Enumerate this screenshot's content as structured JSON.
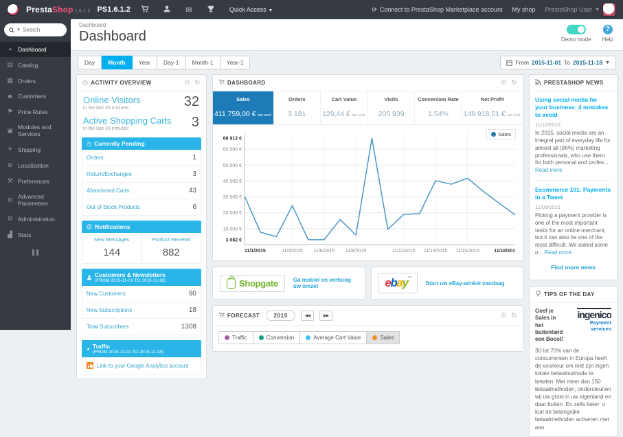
{
  "colors": {
    "topbar_bg": "#363a42",
    "accent_cyan": "#00aff0",
    "section_header": "#29b5e8",
    "sales_tile": "#1d7cb8",
    "chart_line": "#4a96c8",
    "brand_pink": "#f25479",
    "toggle_teal": "#41d6c3",
    "shopgate_green": "#6fb52e",
    "ingenico_navy": "#222c3a",
    "ingenico_blue": "#1274c4",
    "ebay": [
      "#e53238",
      "#0064d2",
      "#f5af02",
      "#86b817"
    ],
    "forecast_traffic": "#a55ca5",
    "forecast_conversion": "#119c80",
    "forecast_avg_cart": "#3fc4f1",
    "forecast_sales": "#f09028"
  },
  "topbar": {
    "brand_presta": "Presta",
    "brand_shop": "Shop",
    "version": "1.6.1.2",
    "shop_name": "PS1.6.1.2",
    "quick_access": "Quick Access",
    "marketplace_link": "Connect to PrestaShop Marketplace account",
    "my_shop": "My shop",
    "user": "PrestaShop User"
  },
  "sidebar": {
    "search_placeholder": "Search",
    "items": [
      {
        "label": "Dashboard"
      },
      {
        "label": "Catalog"
      },
      {
        "label": "Orders"
      },
      {
        "label": "Customers"
      },
      {
        "label": "Price Rules"
      },
      {
        "label": "Modules and Services"
      },
      {
        "label": "Shipping"
      },
      {
        "label": "Localization"
      },
      {
        "label": "Preferences"
      },
      {
        "label": "Advanced Parameters"
      },
      {
        "label": "Administration"
      },
      {
        "label": "Stats"
      }
    ]
  },
  "page": {
    "breadcrumb": "Dashboard",
    "title": "Dashboard",
    "demo_label": "Demo mode",
    "help_label": "Help"
  },
  "toolbar": {
    "ranges": [
      "Day",
      "Month",
      "Year",
      "Day-1",
      "Month-1",
      "Year-1"
    ],
    "from_label": "From",
    "from_date": "2015-11-01",
    "to_label": "To",
    "to_date": "2015-11-18"
  },
  "activity": {
    "title": "ACTIVITY OVERVIEW",
    "online_visitors": {
      "label": "Online Visitors",
      "sub": "in the last 30 minutes",
      "value": "32"
    },
    "active_carts": {
      "label": "Active Shopping Carts",
      "sub": "in the last 30 minutes",
      "value": "3"
    },
    "pending": {
      "header": "Currently Pending",
      "rows": [
        {
          "label": "Orders",
          "value": "1"
        },
        {
          "label": "Return/Exchanges",
          "value": "3"
        },
        {
          "label": "Abandoned Carts",
          "value": "43"
        },
        {
          "label": "Out of Stock Products",
          "value": "6"
        }
      ]
    },
    "notifications": {
      "header": "Notifications",
      "cols": [
        {
          "label": "New Messages",
          "value": "144"
        },
        {
          "label": "Product Reviews",
          "value": "882"
        }
      ]
    },
    "customers": {
      "header": "Customers & Newsletters",
      "sub": "(FROM 2015-11-01 TO 2015-11-18)",
      "rows": [
        {
          "label": "New Customers",
          "value": "90"
        },
        {
          "label": "New Subscriptions",
          "value": "18"
        },
        {
          "label": "Total Subscribers",
          "value": "1308"
        }
      ]
    },
    "traffic": {
      "header": "Traffic",
      "sub": "(FROM 2015-11-01 TO 2015-11-18)",
      "link": "Link to your Google Analytics account"
    }
  },
  "dashboard": {
    "title": "DASHBOARD",
    "kpis": [
      {
        "label": "Sales",
        "value": "411 759,00 €",
        "note": "tax excl.",
        "active": true
      },
      {
        "label": "Orders",
        "value": "3 181",
        "note": ""
      },
      {
        "label": "Cart Value",
        "value": "129,44 €",
        "note": "tax excl."
      },
      {
        "label": "Visits",
        "value": "205 939",
        "note": ""
      },
      {
        "label": "Conversion Rate",
        "value": "1.54%",
        "note": ""
      },
      {
        "label": "Net Profit",
        "value": "148 918,51 €",
        "note": "tax excl."
      }
    ]
  },
  "chart_data": {
    "type": "line",
    "legend": "Sales",
    "line_color": "#4a96c8",
    "ylim": [
      0,
      70000
    ],
    "x": [
      "11/1",
      "11/2",
      "11/3",
      "11/4",
      "11/5",
      "11/6",
      "11/7",
      "11/8",
      "11/9",
      "11/10",
      "11/11",
      "11/12",
      "11/13",
      "11/14",
      "11/15",
      "11/16",
      "11/17",
      "11/18"
    ],
    "values": [
      30500,
      7800,
      5000,
      24500,
      3082,
      3100,
      15800,
      6000,
      66912,
      9500,
      19000,
      19500,
      40200,
      38000,
      41800,
      33500,
      26000,
      18700
    ],
    "y_ticks": [
      {
        "v": 66912,
        "label": "66 912 €",
        "bold": true,
        "grid": false
      },
      {
        "v": 60000,
        "label": "60 000 €",
        "bold": false,
        "grid": true
      },
      {
        "v": 50000,
        "label": "50 000 €",
        "bold": false,
        "grid": true
      },
      {
        "v": 40000,
        "label": "40 000 €",
        "bold": false,
        "grid": true
      },
      {
        "v": 30000,
        "label": "30 000 €",
        "bold": false,
        "grid": true
      },
      {
        "v": 20000,
        "label": "20 000 €",
        "bold": false,
        "grid": true
      },
      {
        "v": 10000,
        "label": "10 000 €",
        "bold": false,
        "grid": true
      },
      {
        "v": 3082,
        "label": "3 082 €",
        "bold": true,
        "grid": false
      }
    ],
    "x_ticks": [
      {
        "i": 0,
        "label": "11/1/2015",
        "bold": true
      },
      {
        "i": 3,
        "label": "11/4/2015",
        "bold": false
      },
      {
        "i": 5,
        "label": "11/6/2015",
        "bold": false
      },
      {
        "i": 7,
        "label": "11/8/2015",
        "bold": false
      },
      {
        "i": 10,
        "label": "11/11/2015",
        "bold": false
      },
      {
        "i": 12,
        "label": "11/13/2015",
        "bold": false
      },
      {
        "i": 14,
        "label": "11/15/2015",
        "bold": false
      },
      {
        "i": 17,
        "label": "11/18/201",
        "bold": true
      }
    ]
  },
  "banners": {
    "shopgate": {
      "logo": "Shopgate",
      "link": "Ga mobiel en verhoog uw omzet"
    },
    "ebay": {
      "l1": "e",
      "l2": "b",
      "l3": "a",
      "l4": "y",
      "tm": "™",
      "link": "Start uw eBay-winkel vandaag"
    }
  },
  "forecast": {
    "title": "FORECAST",
    "year": "2015",
    "prev": "◀◀",
    "next": "▶▶",
    "legend": [
      {
        "label": "Traffic"
      },
      {
        "label": "Conversion"
      },
      {
        "label": "Average Cart Value"
      },
      {
        "label": "Sales"
      }
    ]
  },
  "news": {
    "title": "PRESTASHOP NEWS",
    "articles": [
      {
        "title": "Using social media for your business: 4 mistakes to avoid",
        "date": "11/12/2015",
        "text": "In 2015, social media are an integral part of everyday life for almost all (96%) marketing professionals, who use them for both personal and profes... ",
        "more": "Read more"
      },
      {
        "title": "Ecommerce 101: Payments in a Tweet",
        "date": "11/05/2015",
        "text": "Picking a payment provider is one of the most important tasks for an online merchant, but it can also be one of the most difficult. We asked some o... ",
        "more": "Read more"
      }
    ],
    "find_more": "Find more news"
  },
  "tips": {
    "title": "TIPS OF THE DAY",
    "headline": "Geef je Sales in het buitenland een Boost!",
    "logo_main": "ingenico",
    "logo_sub1": "Payment",
    "logo_sub2": "services",
    "body": "30 tot 70% van de consumenten in Europa heeft de voorkeur om met zijn eigen lokale betaalmethode te betalen. Met meer dan 150 betaalmethoden, ondersteunen wij uw groei in uw eigenland en daar buiten. En zelfs beter: u kun de belangrijke betaalmethoden activeren met een"
  }
}
